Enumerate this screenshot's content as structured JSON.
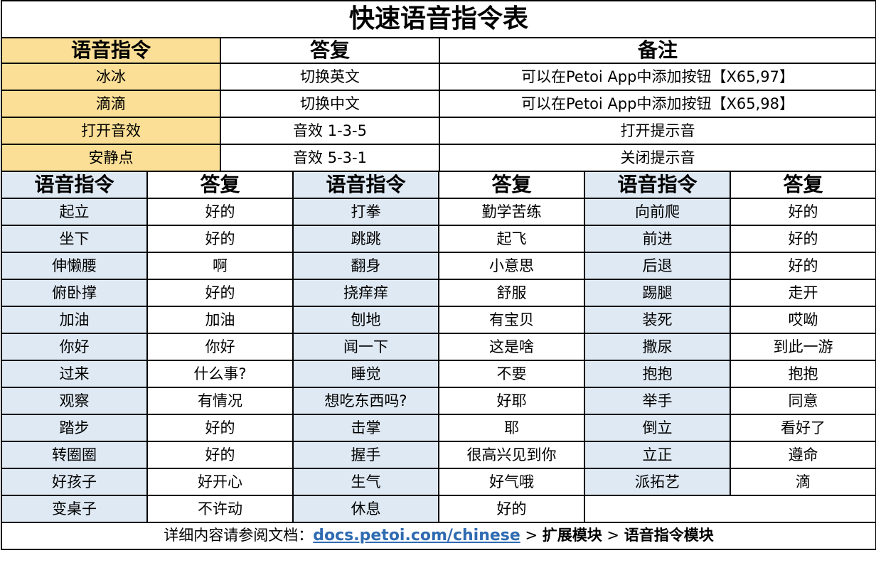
{
  "title": "快速语音指令表",
  "top_table": {
    "headers": [
      "语音指令",
      "答复",
      "备注"
    ],
    "rows": [
      [
        "冰冰",
        "切换英文",
        "可以在Petoi App中添加按钮【X65,97】"
      ],
      [
        "滴滴",
        "切换中文",
        "可以在Petoi App中添加按钮【X65,98】"
      ],
      [
        "打开音效",
        "音效 1-3-5",
        "打开提示音"
      ],
      [
        "安静点",
        "音效 5-3-1",
        "关闭提示音"
      ]
    ]
  },
  "bottom_table": {
    "headers": [
      "语音指令",
      "答复",
      "语音指令",
      "答复",
      "语音指令",
      "答复"
    ],
    "rows": [
      [
        "起立",
        "好的",
        "打拳",
        "勤学苦练",
        "向前爬",
        "好的"
      ],
      [
        "坐下",
        "好的",
        "跳跳",
        "起飞",
        "前进",
        "好的"
      ],
      [
        "伸懒腰",
        "啊",
        "翻身",
        "小意思",
        "后退",
        "好的"
      ],
      [
        "俯卧撑",
        "好的",
        "挠痒痒",
        "舒服",
        "踢腿",
        "走开"
      ],
      [
        "加油",
        "加油",
        "刨地",
        "有宝贝",
        "装死",
        "哎呦"
      ],
      [
        "你好",
        "你好",
        "闻一下",
        "这是啥",
        "撒尿",
        "到此一游"
      ],
      [
        "过来",
        "什么事?",
        "睡觉",
        "不要",
        "抱抱",
        "抱抱"
      ],
      [
        "观察",
        "有情况",
        "想吃东西吗?",
        "好耶",
        "举手",
        "同意"
      ],
      [
        "踏步",
        "好的",
        "击掌",
        "耶",
        "倒立",
        "看好了"
      ],
      [
        "转圈圈",
        "好的",
        "握手",
        "很高兴见到你",
        "立正",
        "遵命"
      ],
      [
        "好孩子",
        "好开心",
        "生气",
        "好气哦",
        "派拓艺",
        "滴"
      ],
      [
        "变桌子",
        "不许动",
        "休息",
        "好的",
        "",
        ""
      ]
    ]
  },
  "footer": {
    "prefix": "详细内容请参阅文档：",
    "link_text": "docs.petoi.com/chinese",
    "sep1": " > ",
    "crumb1": "扩展模块",
    "sep2": " > ",
    "crumb2": "语音指令模块"
  }
}
